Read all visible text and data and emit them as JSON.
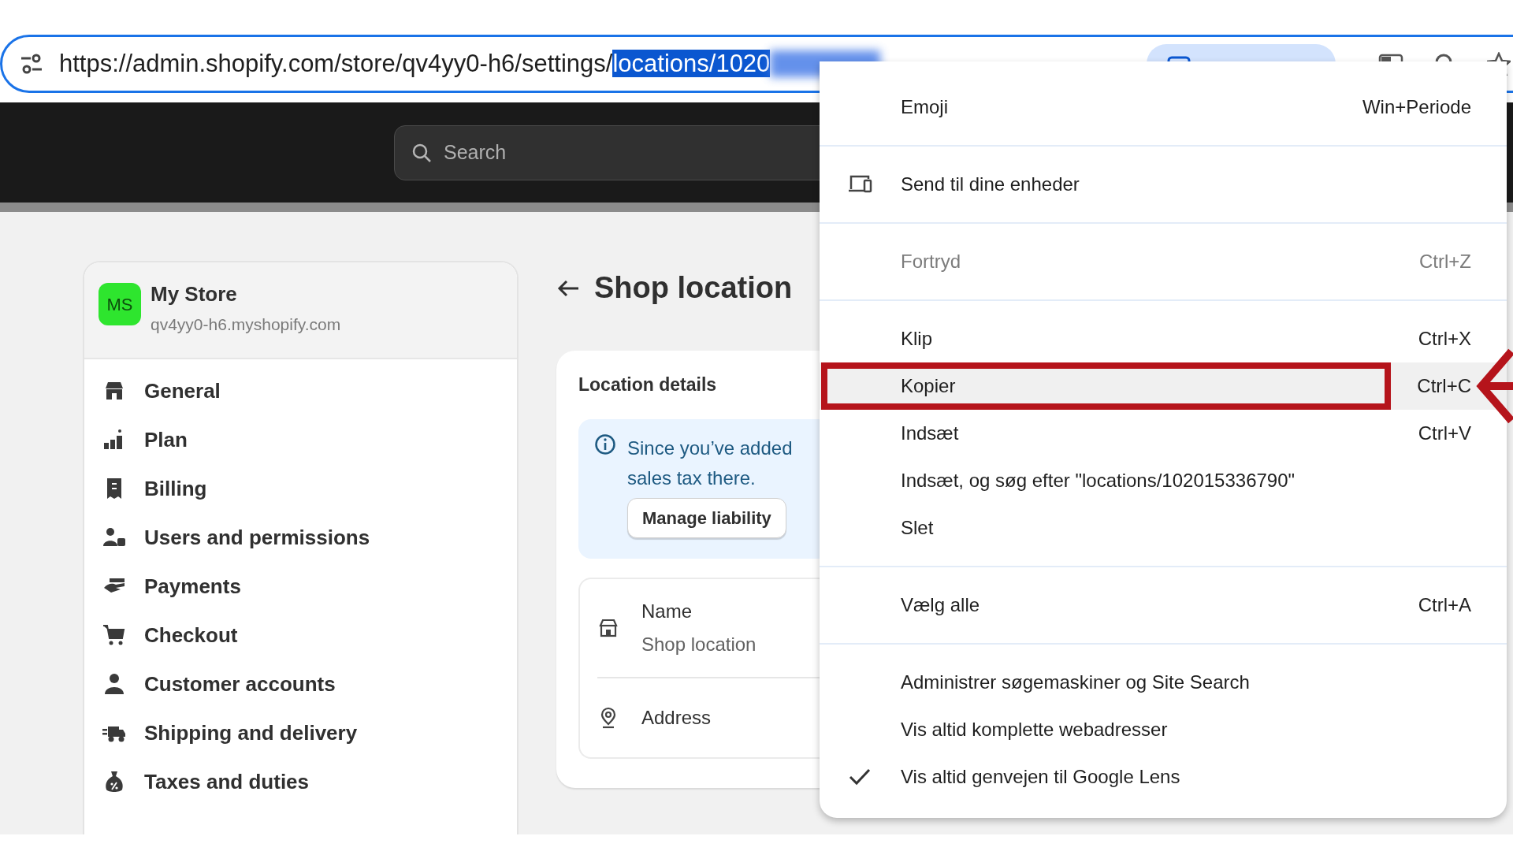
{
  "address_bar": {
    "url": "https://admin.shopify.com/store/qv4yy0-h6/settings/",
    "selected_text": "locations/1020"
  },
  "header": {
    "search": {
      "placeholder": "Search"
    }
  },
  "store": {
    "avatar": "MS",
    "name": "My Store",
    "domain": "qv4yy0-h6.myshopify.com"
  },
  "sidebar": {
    "items": [
      {
        "label": "General"
      },
      {
        "label": "Plan"
      },
      {
        "label": "Billing"
      },
      {
        "label": "Users and permissions"
      },
      {
        "label": "Payments"
      },
      {
        "label": "Checkout"
      },
      {
        "label": "Customer accounts"
      },
      {
        "label": "Shipping and delivery"
      },
      {
        "label": "Taxes and duties"
      }
    ]
  },
  "page": {
    "title": "Shop location",
    "card": {
      "title": "Location details",
      "banner": {
        "lines": [
          "Since you’ve added",
          "sales tax there."
        ],
        "button": "Manage liability"
      },
      "fields": [
        {
          "label": "Name",
          "value": "Shop location"
        },
        {
          "label": "Address"
        }
      ]
    }
  },
  "context_menu": {
    "groups": [
      [
        {
          "kind": "plain",
          "label": "Emoji",
          "shortcut": "Win+Periode",
          "disabled": false,
          "selected": false,
          "checked": false,
          "marked": false
        }
      ],
      [
        {
          "kind": "device",
          "label": "Send til dine enheder",
          "disabled": false,
          "selected": false,
          "checked": false,
          "marked": false
        }
      ],
      [
        {
          "kind": "plain",
          "label": "Fortryd",
          "shortcut": "Ctrl+Z",
          "disabled": true,
          "selected": false,
          "checked": false,
          "marked": false
        }
      ],
      [
        {
          "kind": "plain",
          "label": "Klip",
          "shortcut": "Ctrl+X",
          "disabled": false,
          "selected": false,
          "checked": false,
          "marked": false
        },
        {
          "kind": "plain",
          "label": "Kopier",
          "shortcut": "Ctrl+C",
          "disabled": false,
          "selected": true,
          "checked": false,
          "marked": true
        },
        {
          "kind": "plain",
          "label": "Indsæt",
          "shortcut": "Ctrl+V",
          "disabled": false,
          "selected": false,
          "checked": false,
          "marked": false
        },
        {
          "kind": "plain",
          "label": "Indsæt, og søg efter \"locations/102015336790\"",
          "disabled": false,
          "selected": false,
          "checked": false,
          "marked": false
        },
        {
          "kind": "plain",
          "label": "Slet",
          "disabled": false,
          "selected": false,
          "checked": false,
          "marked": false
        }
      ],
      [
        {
          "kind": "plain",
          "label": "Vælg alle",
          "shortcut": "Ctrl+A",
          "disabled": false,
          "selected": false,
          "checked": false,
          "marked": false
        }
      ],
      [
        {
          "kind": "plain",
          "label": "Administrer søgemaskiner og Site Search",
          "disabled": false,
          "selected": false,
          "checked": false,
          "marked": false
        },
        {
          "kind": "plain",
          "label": "Vis altid komplette webadresser",
          "disabled": false,
          "selected": false,
          "checked": false,
          "marked": false
        },
        {
          "kind": "plain",
          "label": "Vis altid genvejen til Google Lens",
          "disabled": false,
          "selected": false,
          "checked": true,
          "marked": false
        }
      ]
    ]
  }
}
